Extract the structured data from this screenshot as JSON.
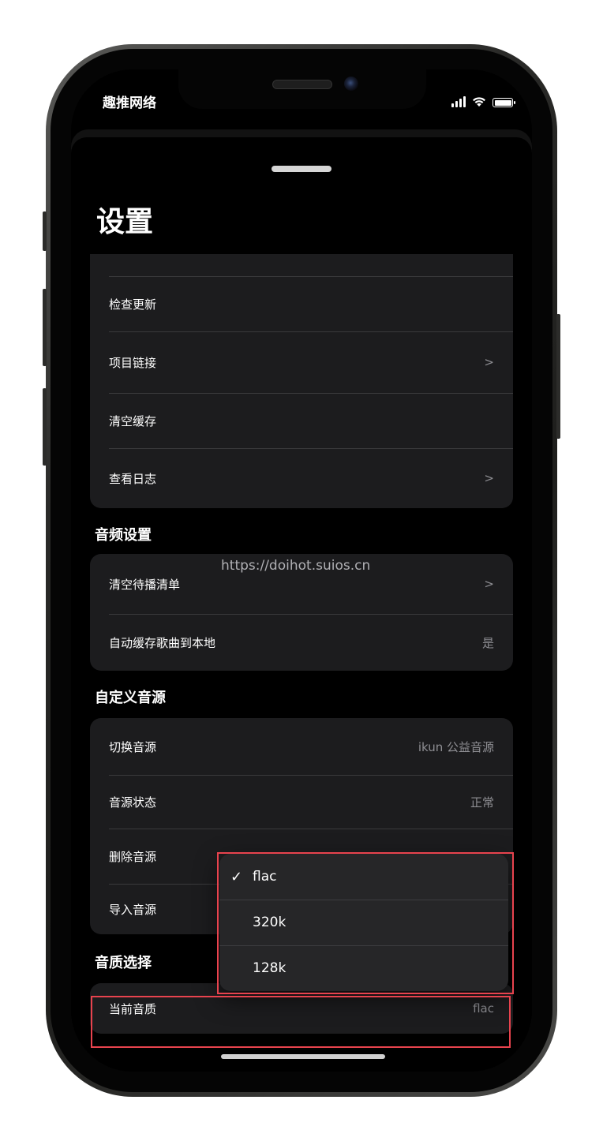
{
  "status_bar": {
    "carrier": "趣推网络",
    "icons": [
      "cellular-signal-icon",
      "wifi-icon",
      "battery-icon"
    ]
  },
  "page": {
    "title": "设置"
  },
  "about_card": {
    "rows": [
      {
        "label": "检查更新",
        "value": ""
      },
      {
        "label": "项目链接",
        "value": ">"
      },
      {
        "label": "清空缓存",
        "value": ""
      },
      {
        "label": "查看日志",
        "value": ">"
      }
    ]
  },
  "audio_settings": {
    "header": "音频设置",
    "rows": [
      {
        "label": "清空待播清单",
        "value": ">"
      },
      {
        "label": "自动缓存歌曲到本地",
        "value": "是"
      }
    ]
  },
  "watermark": "https://doihot.suios.cn",
  "custom_source": {
    "header": "自定义音源",
    "rows": [
      {
        "label": "切换音源",
        "value": "ikun 公益音源"
      },
      {
        "label": "音源状态",
        "value": "正常"
      },
      {
        "label": "删除音源",
        "value": ""
      },
      {
        "label": "导入音源",
        "value": ""
      }
    ]
  },
  "quality": {
    "header": "音质选择",
    "current_label": "当前音质",
    "current_value": "flac",
    "options": [
      {
        "label": "flac",
        "selected": true
      },
      {
        "label": "320k",
        "selected": false
      },
      {
        "label": "128k",
        "selected": false
      }
    ],
    "check_mark": "✓"
  },
  "colors": {
    "accent_highlight": "#e8434e",
    "card_background": "#1c1c1e",
    "secondary_text": "#8e8e93"
  }
}
